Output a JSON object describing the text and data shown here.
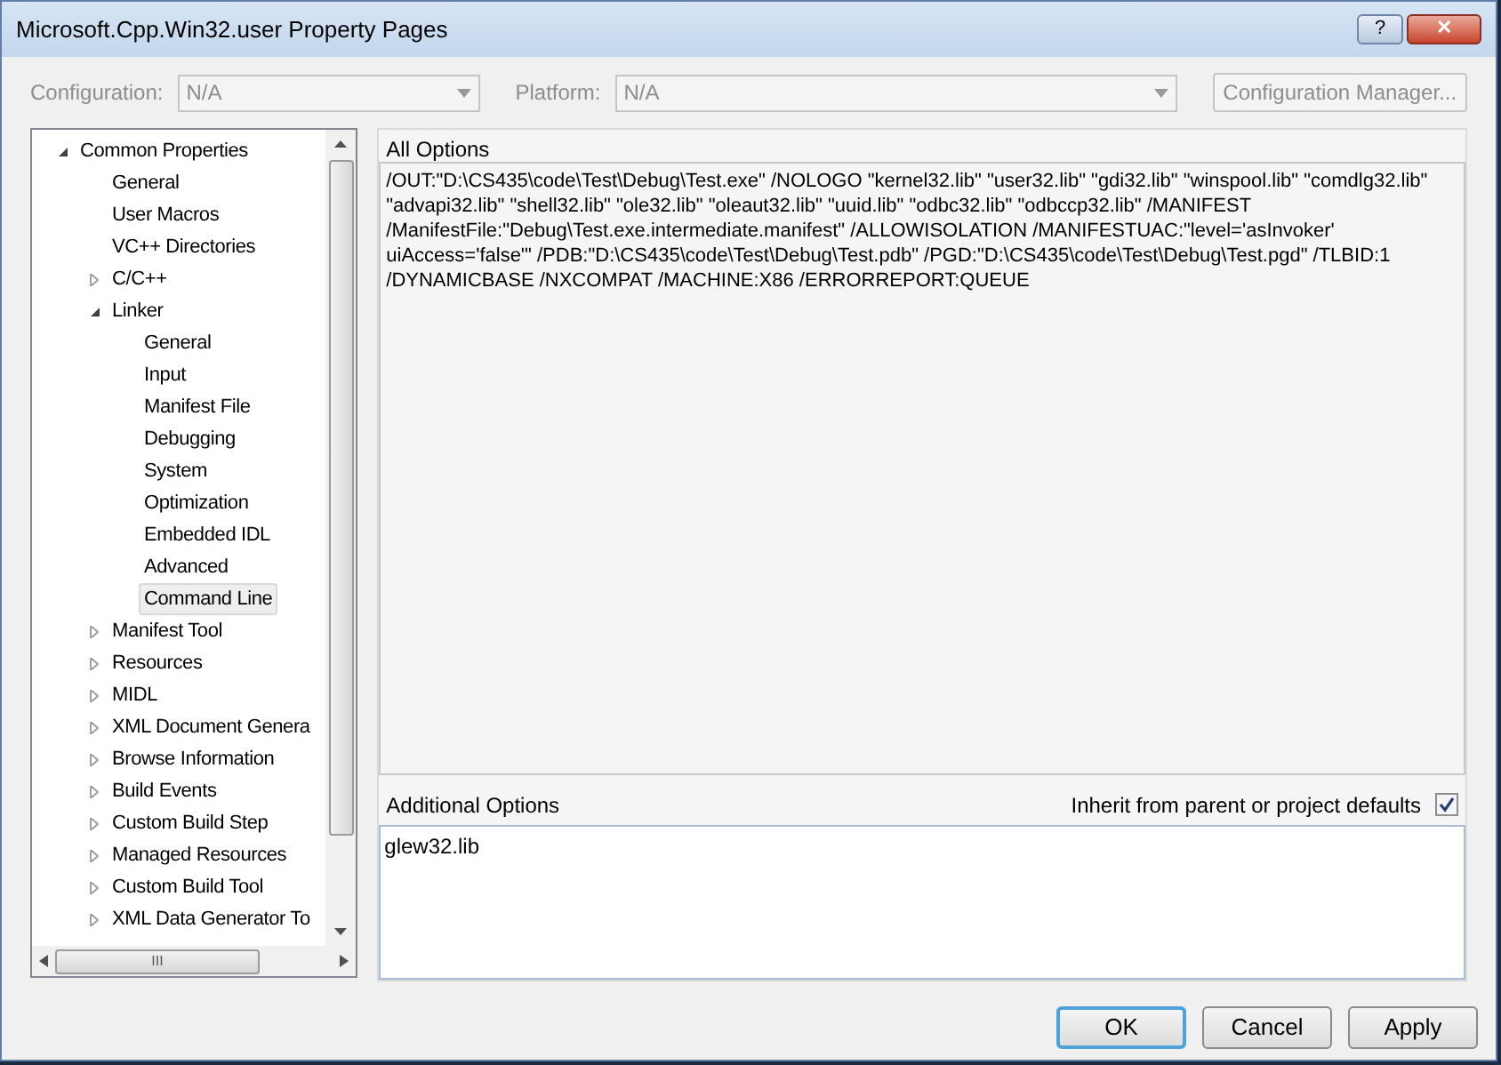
{
  "window": {
    "title": "Microsoft.Cpp.Win32.user Property Pages",
    "buttons": [
      "?",
      "✕"
    ]
  },
  "toolbar": {
    "configuration": {
      "label": "Configuration:",
      "value": "N/A",
      "disabled": true
    },
    "platform": {
      "label": "Platform:",
      "value": "N/A",
      "disabled": true
    },
    "manager_button": {
      "label": "Configuration Manager...",
      "disabled": true
    }
  },
  "tree": [
    {
      "label": "Common Properties",
      "expanded": true,
      "selected": false,
      "children": [
        {
          "label": "General",
          "selected": false
        },
        {
          "label": "User Macros",
          "selected": false
        },
        {
          "label": "VC++ Directories",
          "selected": false
        },
        {
          "label": "C/C++",
          "expanded": false,
          "selected": false
        },
        {
          "label": "Linker",
          "expanded": true,
          "selected": false,
          "children": [
            {
              "label": "General",
              "selected": false
            },
            {
              "label": "Input",
              "selected": false
            },
            {
              "label": "Manifest File",
              "selected": false
            },
            {
              "label": "Debugging",
              "selected": false
            },
            {
              "label": "System",
              "selected": false
            },
            {
              "label": "Optimization",
              "selected": false
            },
            {
              "label": "Embedded IDL",
              "selected": false
            },
            {
              "label": "Advanced",
              "selected": false
            },
            {
              "label": "Command Line",
              "selected": true
            }
          ]
        },
        {
          "label": "Manifest Tool",
          "expanded": false,
          "selected": false
        },
        {
          "label": "Resources",
          "expanded": false,
          "selected": false
        },
        {
          "label": "MIDL",
          "expanded": false,
          "selected": false
        },
        {
          "label": "XML Document Genera",
          "expanded": false,
          "selected": false
        },
        {
          "label": "Browse Information",
          "expanded": false,
          "selected": false
        },
        {
          "label": "Build Events",
          "expanded": false,
          "selected": false
        },
        {
          "label": "Custom Build Step",
          "expanded": false,
          "selected": false
        },
        {
          "label": "Managed Resources",
          "expanded": false,
          "selected": false
        },
        {
          "label": "Custom Build Tool",
          "expanded": false,
          "selected": false
        },
        {
          "label": "XML Data Generator To",
          "expanded": false,
          "selected": false
        }
      ]
    }
  ],
  "scrollbar_grip": "III",
  "all_options": {
    "label": "All Options",
    "text": "/OUT:\"D:\\CS435\\code\\Test\\Debug\\Test.exe\" /NOLOGO \"kernel32.lib\" \"user32.lib\" \"gdi32.lib\" \"winspool.lib\" \"comdlg32.lib\" \"advapi32.lib\" \"shell32.lib\" \"ole32.lib\" \"oleaut32.lib\" \"uuid.lib\" \"odbc32.lib\" \"odbccp32.lib\" /MANIFEST /ManifestFile:\"Debug\\Test.exe.intermediate.manifest\" /ALLOWISOLATION /MANIFESTUAC:\"level='asInvoker' uiAccess='false'\" /PDB:\"D:\\CS435\\code\\Test\\Debug\\Test.pdb\" /PGD:\"D:\\CS435\\code\\Test\\Debug\\Test.pgd\" /TLBID:1 /DYNAMICBASE /NXCOMPAT /MACHINE:X86 /ERRORREPORT:QUEUE"
  },
  "additional_options": {
    "label": "Additional Options",
    "inherit_label": "Inherit from parent or project defaults",
    "inherit_checked": true,
    "value": "glew32.lib"
  },
  "buttons": [
    {
      "label": "OK",
      "selected": true
    },
    {
      "label": "Cancel",
      "selected": false
    },
    {
      "label": "Apply",
      "selected": false
    }
  ]
}
